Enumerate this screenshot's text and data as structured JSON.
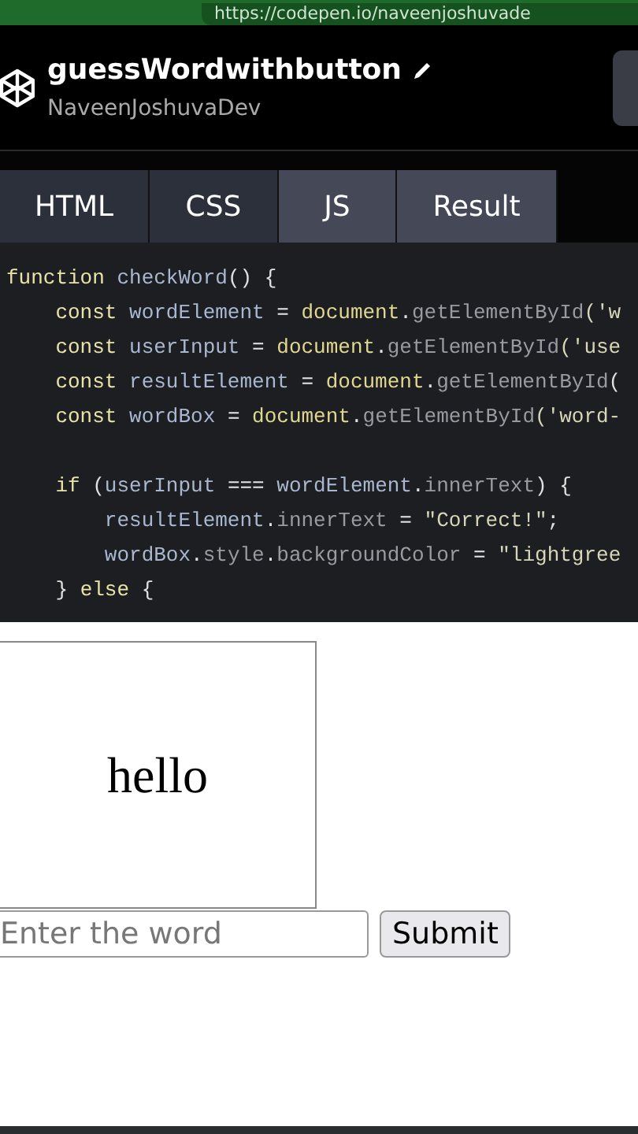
{
  "browser": {
    "url": "https://codepen.io/naveenjoshuvade"
  },
  "header": {
    "title": "guessWordwithbutton",
    "author": "NaveenJoshuvaDev"
  },
  "tabs": [
    {
      "label": "HTML",
      "selected": false
    },
    {
      "label": "CSS",
      "selected": false
    },
    {
      "label": "JS",
      "selected": true
    },
    {
      "label": "Result",
      "selected": true
    }
  ],
  "code": [
    [
      {
        "text": "function",
        "kind": "kw"
      },
      {
        "text": " checkWord",
        "kind": "ident"
      },
      {
        "text": "() {",
        "kind": "punct"
      }
    ],
    [
      {
        "text": "    const",
        "kind": "kw"
      },
      {
        "text": " wordElement",
        "kind": "ident"
      },
      {
        "text": " = ",
        "kind": "punct"
      },
      {
        "text": "document",
        "kind": "obj"
      },
      {
        "text": ".",
        "kind": "punct"
      },
      {
        "text": "getElementById",
        "kind": "method"
      },
      {
        "text": "('w",
        "kind": "str"
      }
    ],
    [
      {
        "text": "    const",
        "kind": "kw"
      },
      {
        "text": " userInput",
        "kind": "ident"
      },
      {
        "text": " = ",
        "kind": "punct"
      },
      {
        "text": "document",
        "kind": "obj"
      },
      {
        "text": ".",
        "kind": "punct"
      },
      {
        "text": "getElementById",
        "kind": "method"
      },
      {
        "text": "('use",
        "kind": "str"
      }
    ],
    [
      {
        "text": "    const",
        "kind": "kw"
      },
      {
        "text": " resultElement",
        "kind": "ident"
      },
      {
        "text": " = ",
        "kind": "punct"
      },
      {
        "text": "document",
        "kind": "obj"
      },
      {
        "text": ".",
        "kind": "punct"
      },
      {
        "text": "getElementById",
        "kind": "method"
      },
      {
        "text": "(",
        "kind": "punct"
      }
    ],
    [
      {
        "text": "    const",
        "kind": "kw"
      },
      {
        "text": " wordBox",
        "kind": "ident"
      },
      {
        "text": " = ",
        "kind": "punct"
      },
      {
        "text": "document",
        "kind": "obj"
      },
      {
        "text": ".",
        "kind": "punct"
      },
      {
        "text": "getElementById",
        "kind": "method"
      },
      {
        "text": "('word-",
        "kind": "str"
      }
    ],
    {
      "gap_before": true,
      "tokens": [
        {
          "text": "    if",
          "kind": "kw"
        },
        {
          "text": " (",
          "kind": "punct"
        },
        {
          "text": "userInput",
          "kind": "ident"
        },
        {
          "text": " === ",
          "kind": "punct"
        },
        {
          "text": "wordElement",
          "kind": "ident"
        },
        {
          "text": ".",
          "kind": "punct"
        },
        {
          "text": "innerText",
          "kind": "method"
        },
        {
          "text": ") {",
          "kind": "punct"
        }
      ]
    },
    [
      {
        "text": "        resultElement",
        "kind": "ident"
      },
      {
        "text": ".",
        "kind": "punct"
      },
      {
        "text": "innerText",
        "kind": "method"
      },
      {
        "text": " = ",
        "kind": "punct"
      },
      {
        "text": "\"Correct!\"",
        "kind": "str"
      },
      {
        "text": ";",
        "kind": "punct"
      }
    ],
    [
      {
        "text": "        wordBox",
        "kind": "ident"
      },
      {
        "text": ".",
        "kind": "punct"
      },
      {
        "text": "style",
        "kind": "method"
      },
      {
        "text": ".",
        "kind": "punct"
      },
      {
        "text": "backgroundColor",
        "kind": "method"
      },
      {
        "text": " = ",
        "kind": "punct"
      },
      {
        "text": "\"lightgree",
        "kind": "str"
      }
    ],
    [
      {
        "text": "    } ",
        "kind": "punct"
      },
      {
        "text": "else",
        "kind": "kw"
      },
      {
        "text": " {",
        "kind": "punct"
      }
    ]
  ],
  "result": {
    "word": "hello",
    "input": {
      "placeholder": "Enter the word"
    },
    "button": "Submit"
  }
}
